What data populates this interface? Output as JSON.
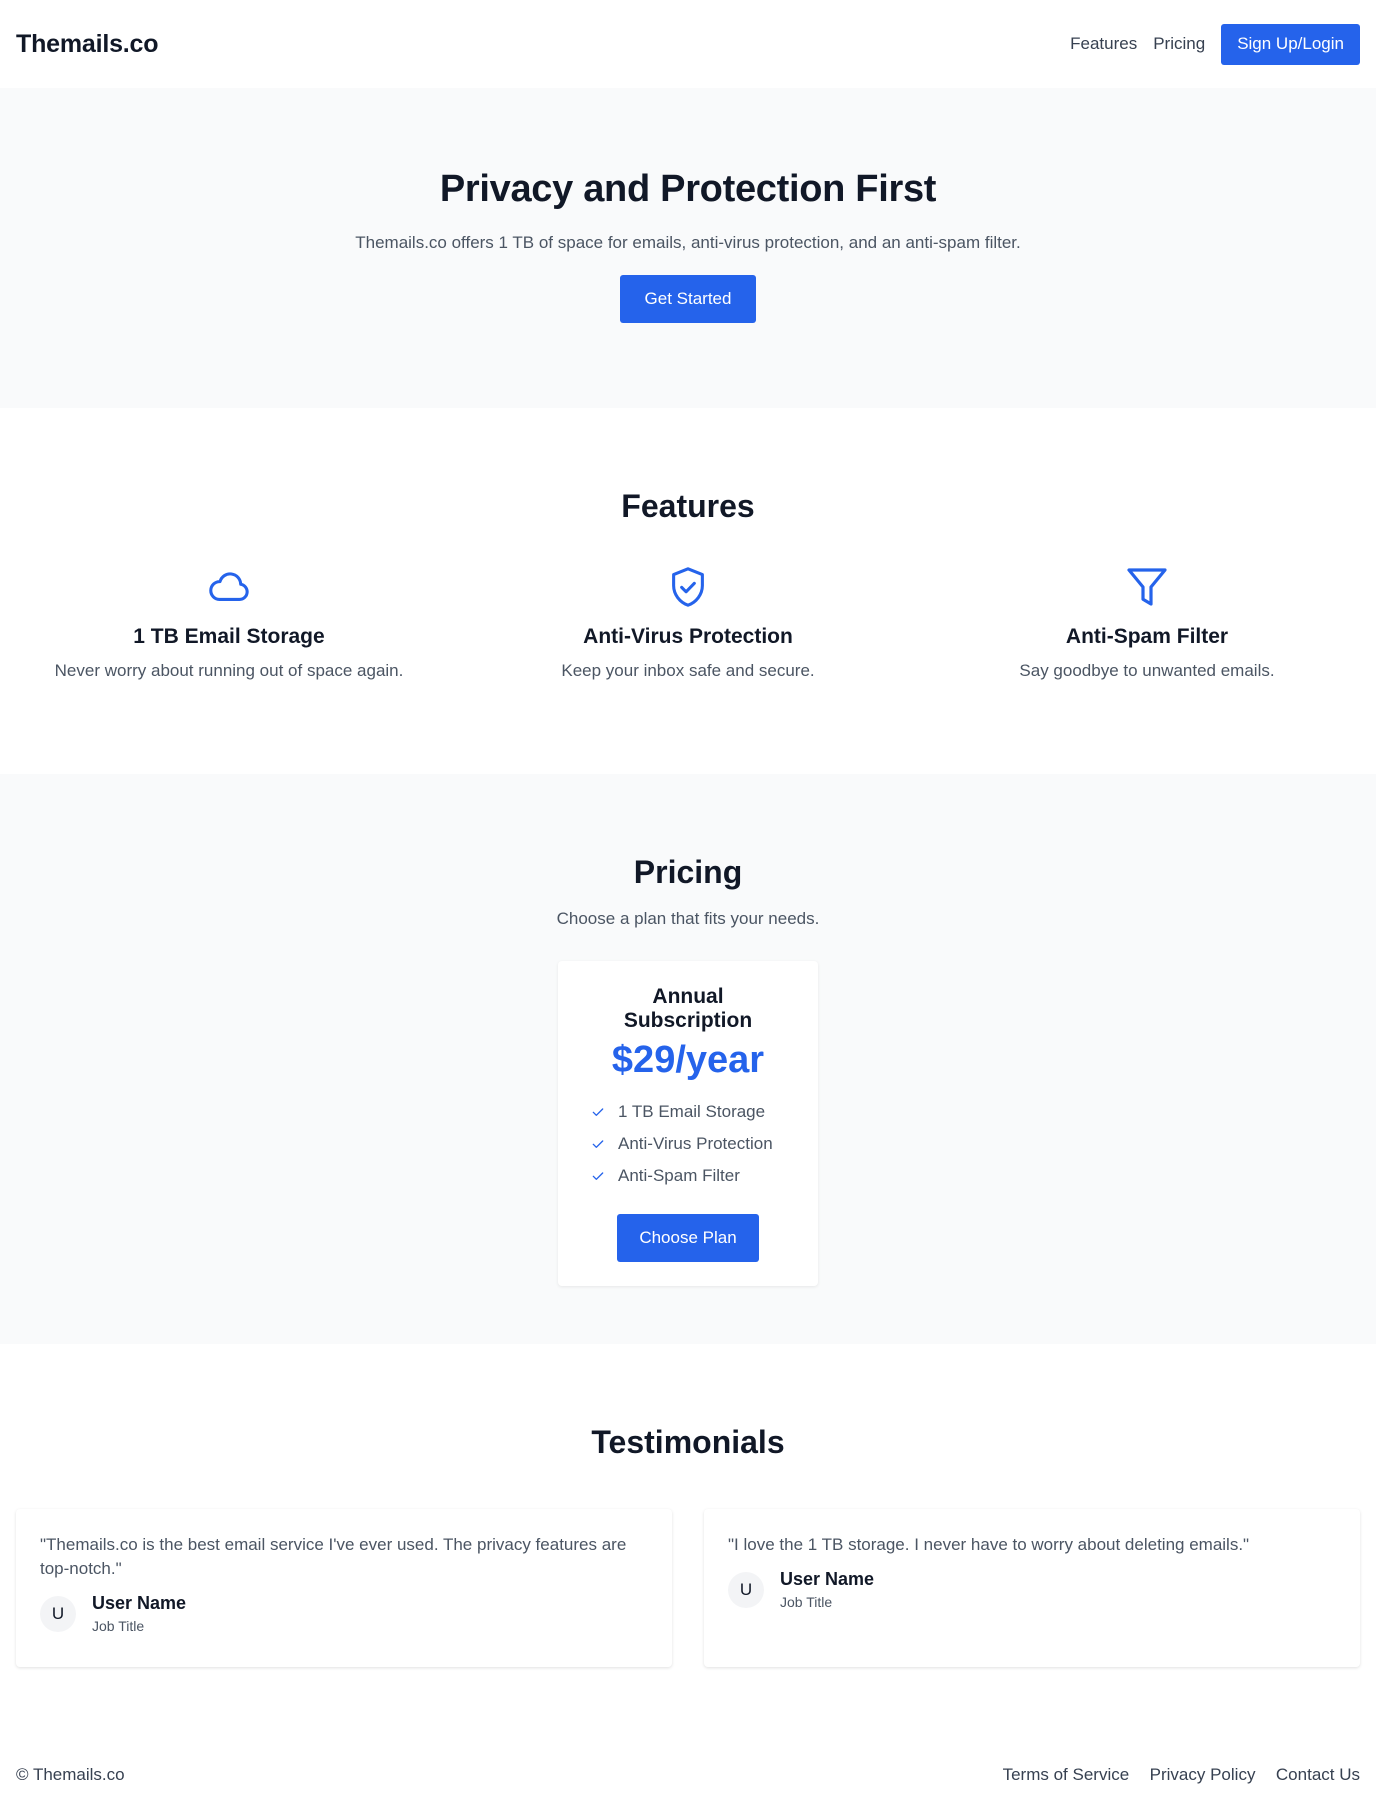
{
  "header": {
    "brand": "Themails.co",
    "nav": [
      {
        "label": "Features"
      },
      {
        "label": "Pricing"
      }
    ],
    "cta": "Sign Up/Login"
  },
  "hero": {
    "title": "Privacy and Protection First",
    "subtitle": "Themails.co offers 1 TB of space for emails, anti-virus protection, and an anti-spam filter.",
    "button": "Get Started"
  },
  "features": {
    "title": "Features",
    "items": [
      {
        "icon": "cloud-icon",
        "title": "1 TB Email Storage",
        "text": "Never worry about running out of space again."
      },
      {
        "icon": "shield-check-icon",
        "title": "Anti-Virus Protection",
        "text": "Keep your inbox safe and secure."
      },
      {
        "icon": "filter-icon",
        "title": "Anti-Spam Filter",
        "text": "Say goodbye to unwanted emails."
      }
    ]
  },
  "pricing": {
    "title": "Pricing",
    "subtitle": "Choose a plan that fits your needs.",
    "plan": {
      "name": "Annual Subscription",
      "price": "$29/year",
      "items": [
        "1 TB Email Storage",
        "Anti-Virus Protection",
        "Anti-Spam Filter"
      ],
      "button": "Choose Plan"
    }
  },
  "testimonials": {
    "title": "Testimonials",
    "items": [
      {
        "quote": "\"Themails.co is the best email service I've ever used. The privacy features are top-notch.\"",
        "initial": "U",
        "name": "User Name",
        "job": "Job Title"
      },
      {
        "quote": "\"I love the 1 TB storage. I never have to worry about deleting emails.\"",
        "initial": "U",
        "name": "User Name",
        "job": "Job Title"
      }
    ]
  },
  "footer": {
    "copyright": "© Themails.co",
    "links": [
      "Terms of Service",
      "Privacy Policy",
      "Contact Us"
    ]
  },
  "colors": {
    "accent": "#2563eb",
    "section_bg": "#f9fafb",
    "text_dark": "#111827",
    "text_muted": "#4b5563"
  }
}
